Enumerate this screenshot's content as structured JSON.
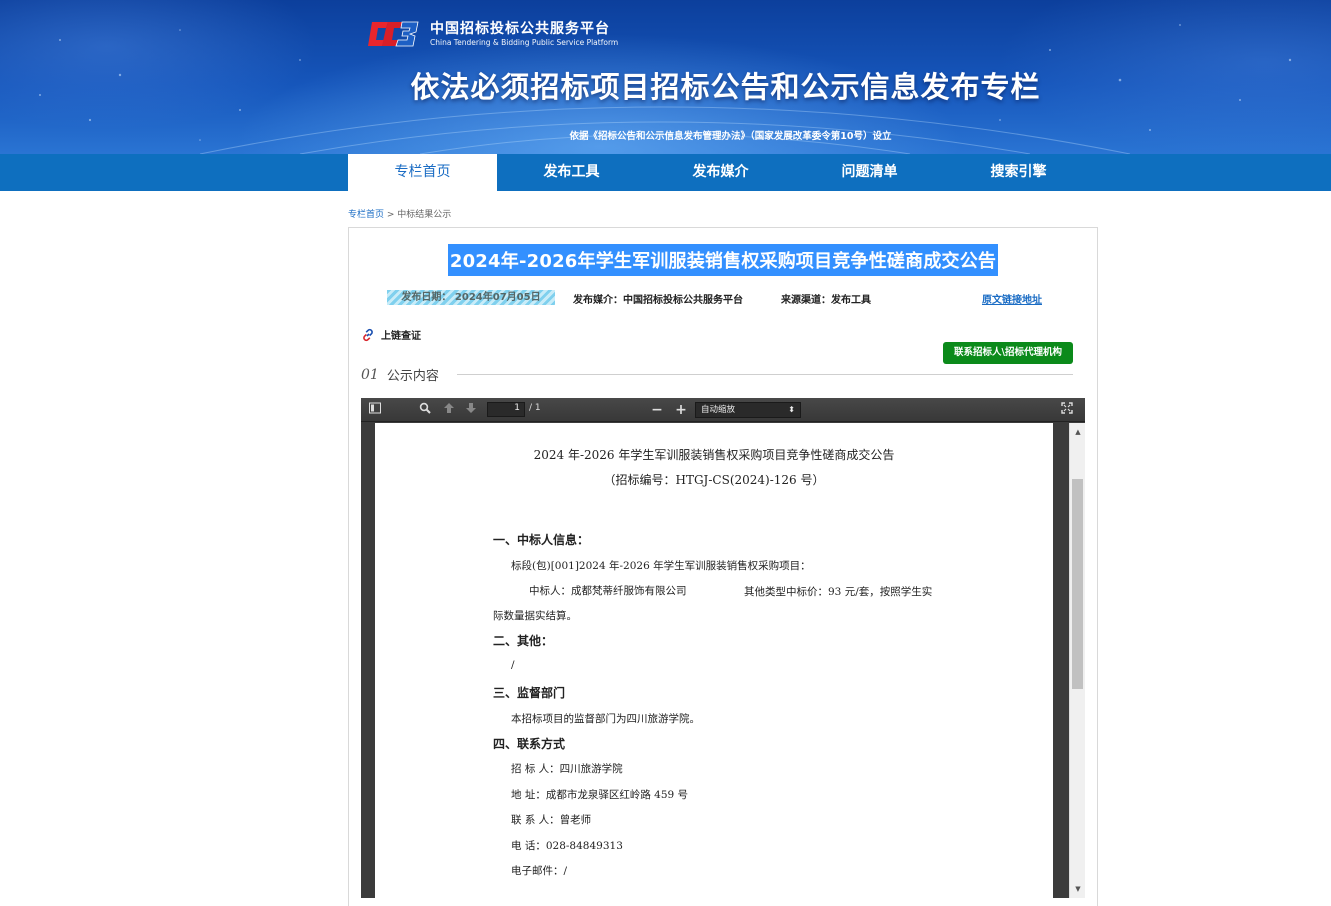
{
  "banner": {
    "logo_cn": "中国招标投标公共服务平台",
    "logo_en": "China Tendering & Bidding Public Service Platform",
    "title": "依法必须招标项目招标公告和公示信息发布专栏",
    "subtitle": "依据《招标公告和公示信息发布管理办法》（国家发展改革委令第10号）设立"
  },
  "nav": {
    "items": [
      {
        "label": "专栏首页",
        "active": true
      },
      {
        "label": "发布工具"
      },
      {
        "label": "发布媒介"
      },
      {
        "label": "问题清单"
      },
      {
        "label": "搜索引擎"
      }
    ]
  },
  "breadcrumb": {
    "home": "专栏首页",
    "sep": " > ",
    "current": "中标结果公示"
  },
  "notice": {
    "title": "2024年-2026年学生军训服装销售权采购项目竞争性磋商成交公告",
    "date": "发布日期：  2024年07月05日",
    "media": "发布媒介：中国招标投标公共服务平台",
    "source": "来源渠道：发布工具",
    "link": "原文链接地址",
    "chain": "上链查证",
    "contact_button": "联系招标人\\招标代理机构",
    "section_num": "01",
    "section_label": "公示内容"
  },
  "viewer": {
    "page_current": "1",
    "page_total": "/ 1",
    "zoom": "自动缩放"
  },
  "pdf": {
    "title": "2024 年-2026 年学生军训服装销售权采购项目竞争性磋商成交公告",
    "code": "（招标编号：HTGJ-CS(2024)-126 号）",
    "h1": "一、中标人信息：",
    "lot": "标段(包)[001]2024 年-2026 年学生军训服装销售权采购项目：",
    "winner": "中标人：成都梵蒂纤服饰有限公司",
    "price": "其他类型中标价：93 元/套，按照学生实",
    "price_cont": "际数量据实结算。",
    "h2": "二、其他：",
    "other": "/",
    "h3": "三、监督部门",
    "supervisor": "本招标项目的监督部门为四川旅游学院。",
    "h4": "四、联系方式",
    "c_tenderer": "招 标 人：四川旅游学院",
    "c_address": "地    址：成都市龙泉驿区红岭路 459 号",
    "c_contact": "联 系 人：曾老师",
    "c_phone": "电    话：028-84849313",
    "c_email": "电子邮件：/"
  },
  "colors": {
    "nav_bg": "#0e6fbf",
    "title_highlight": "#3390ff",
    "contact_btn": "#0b8a1a",
    "link": "#1a6cc4"
  }
}
